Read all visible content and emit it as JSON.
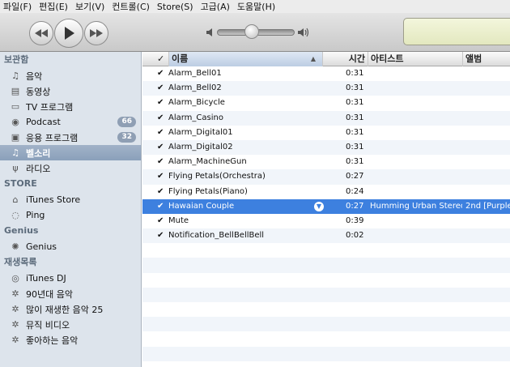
{
  "menu": [
    "파일(F)",
    "편집(E)",
    "보기(V)",
    "컨트롤(C)",
    "Store(S)",
    "고급(A)",
    "도움말(H)"
  ],
  "sidebar": {
    "library_header": "보관함",
    "library": [
      {
        "label": "음악",
        "icon": "music-note-icon"
      },
      {
        "label": "동영상",
        "icon": "film-icon"
      },
      {
        "label": "TV 프로그램",
        "icon": "tv-icon"
      },
      {
        "label": "Podcast",
        "icon": "podcast-icon",
        "badge": "66"
      },
      {
        "label": "응용 프로그램",
        "icon": "apps-icon",
        "badge": "32"
      },
      {
        "label": "벨소리",
        "icon": "bell-icon",
        "selected": true
      },
      {
        "label": "라디오",
        "icon": "radio-icon"
      }
    ],
    "store_header": "STORE",
    "store": [
      {
        "label": "iTunes Store",
        "icon": "store-icon"
      },
      {
        "label": "Ping",
        "icon": "ping-icon"
      }
    ],
    "genius_header": "Genius",
    "genius": [
      {
        "label": "Genius",
        "icon": "genius-icon"
      }
    ],
    "playlists_header": "재생목록",
    "playlists": [
      {
        "label": "iTunes DJ",
        "icon": "dj-icon"
      },
      {
        "label": "90년대 음악",
        "icon": "smart-playlist-icon"
      },
      {
        "label": "많이 재생한 음악 25",
        "icon": "smart-playlist-icon"
      },
      {
        "label": "뮤직 비디오",
        "icon": "smart-playlist-icon"
      },
      {
        "label": "좋아하는 음악",
        "icon": "smart-playlist-icon"
      }
    ]
  },
  "columns": {
    "check": "✓",
    "name": "이름",
    "time": "시간",
    "artist": "아티스트",
    "album": "앨범"
  },
  "songs": [
    {
      "checked": true,
      "name": "Alarm_Bell01",
      "time": "0:31",
      "artist": "",
      "album": ""
    },
    {
      "checked": true,
      "name": "Alarm_Bell02",
      "time": "0:31",
      "artist": "",
      "album": ""
    },
    {
      "checked": true,
      "name": "Alarm_Bicycle",
      "time": "0:31",
      "artist": "",
      "album": ""
    },
    {
      "checked": true,
      "name": "Alarm_Casino",
      "time": "0:31",
      "artist": "",
      "album": ""
    },
    {
      "checked": true,
      "name": "Alarm_Digital01",
      "time": "0:31",
      "artist": "",
      "album": ""
    },
    {
      "checked": true,
      "name": "Alarm_Digital02",
      "time": "0:31",
      "artist": "",
      "album": ""
    },
    {
      "checked": true,
      "name": "Alarm_MachineGun",
      "time": "0:31",
      "artist": "",
      "album": ""
    },
    {
      "checked": true,
      "name": "Flying Petals(Orchestra)",
      "time": "0:27",
      "artist": "",
      "album": ""
    },
    {
      "checked": true,
      "name": "Flying Petals(Piano)",
      "time": "0:24",
      "artist": "",
      "album": ""
    },
    {
      "checked": true,
      "name": "Hawaian Couple",
      "time": "0:27",
      "artist": "Humming Urban Stereo",
      "album": "2nd [Purple",
      "selected": true
    },
    {
      "checked": true,
      "name": "Mute",
      "time": "0:39",
      "artist": "",
      "album": ""
    },
    {
      "checked": true,
      "name": "Notification_BellBellBell",
      "time": "0:02",
      "artist": "",
      "album": ""
    },
    {
      "name": "",
      "time": "",
      "artist": "",
      "album": ""
    },
    {
      "name": "",
      "time": "",
      "artist": "",
      "album": ""
    },
    {
      "name": "",
      "time": "",
      "artist": "",
      "album": ""
    },
    {
      "name": "",
      "time": "",
      "artist": "",
      "album": ""
    },
    {
      "name": "",
      "time": "",
      "artist": "",
      "album": ""
    },
    {
      "name": "",
      "time": "",
      "artist": "",
      "album": ""
    },
    {
      "name": "",
      "time": "",
      "artist": "",
      "album": ""
    },
    {
      "name": "",
      "time": "",
      "artist": "",
      "album": ""
    }
  ],
  "colors": {
    "sidebar_bg": "#dde4ec",
    "selected_row": "#3d80df",
    "lcd": "#eef2d0"
  }
}
